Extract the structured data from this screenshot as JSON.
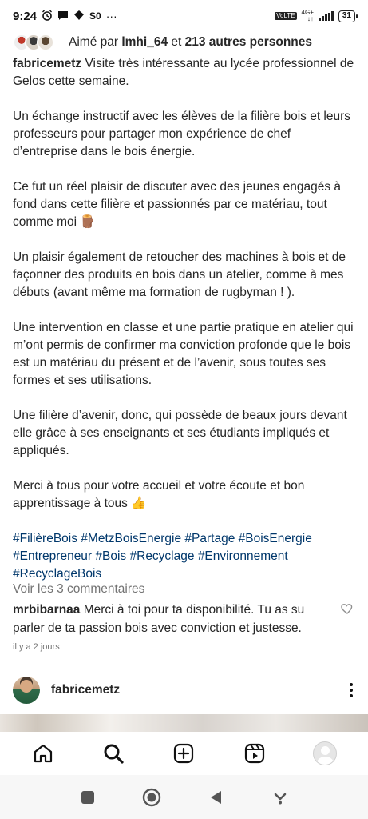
{
  "status_bar": {
    "time": "9:24",
    "network_type": "4G+",
    "lte_badge": "VoLTE",
    "battery": "31",
    "more_notifications": "···"
  },
  "likes": {
    "prefix": "Aimé par ",
    "user": "lmhi_64",
    "middle": " et ",
    "others": "213 autres personnes"
  },
  "caption": {
    "username": "fabricemetz",
    "paragraphs": [
      "Visite très intéressante au lycée professionnel de Gelos cette semaine.",
      "Un échange instructif avec les élèves de la filière bois et leurs professeurs pour partager mon expérience de chef d’entreprise dans le bois énergie.",
      "Ce fut un réel plaisir de discuter avec des jeunes engagés à fond dans cette filière et passionnés par ce matériau, tout comme moi 🪵",
      "Un plaisir également de retoucher des machines à bois et de façonner des produits en bois dans un atelier, comme à mes débuts (avant même ma formation de rugbyman ! ).",
      "Une intervention en classe et une partie pratique en atelier qui m’ont permis de confirmer ma conviction profonde que le bois est un matériau du présent et de l’avenir, sous toutes ses formes et ses utilisations.",
      "Une filière d’avenir, donc, qui possède de beaux jours devant elle grâce à ses enseignants et ses étudiants impliqués et appliqués.",
      "Merci à tous pour votre accueil et votre écoute et bon apprentissage à tous 👍"
    ],
    "hashtags": [
      "#FilièreBois",
      "#MetzBoisEnergie",
      "#Partage",
      "#BoisEnergie",
      "#Entrepreneur",
      "#Bois",
      "#Recyclage",
      "#Environnement",
      "#RecyclageBois"
    ]
  },
  "comments": {
    "view_all": "Voir les 3 commentaires",
    "items": [
      {
        "user": "mrbibarnaa",
        "text": "Merci à toi pour ta disponibilité. Tu as su parler de ta passion bois avec conviction et justesse."
      }
    ]
  },
  "timestamp": "il y a 2 jours",
  "next_post": {
    "username": "fabricemetz"
  },
  "bottom_nav": {
    "items": [
      "home-icon",
      "search-icon",
      "create-icon",
      "reels-icon",
      "profile-avatar"
    ]
  },
  "system_nav": {
    "items": [
      "recents-button",
      "home-button",
      "back-button",
      "assistant-button"
    ]
  },
  "colors": {
    "hashtag": "#00376b",
    "secondary_text": "#737373",
    "primary_text": "#262626"
  }
}
